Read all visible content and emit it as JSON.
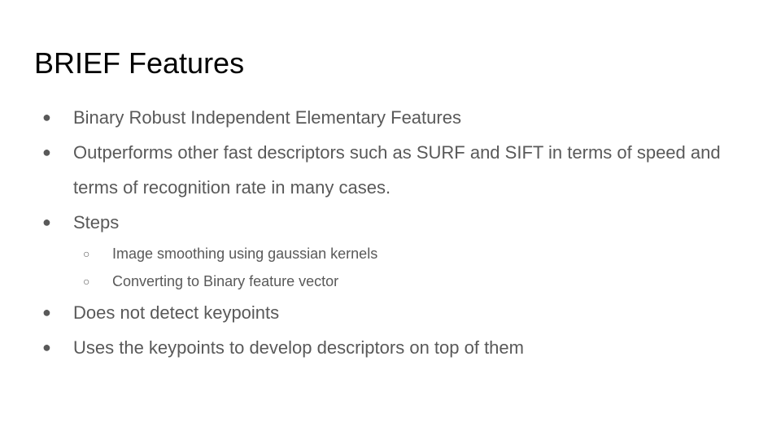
{
  "slide": {
    "title": "BRIEF Features",
    "bullets": [
      {
        "marker": "●",
        "text": "Binary Robust Independent Elementary Features"
      },
      {
        "marker": "●",
        "text": "Outperforms other fast descriptors such as SURF and SIFT in terms of speed and terms of recognition rate in many cases."
      },
      {
        "marker": "●",
        "text": "Steps"
      },
      {
        "marker": "●",
        "text": "Does not detect keypoints"
      },
      {
        "marker": "●",
        "text": "Uses the keypoints to develop descriptors on top of them"
      }
    ],
    "sub_bullets": [
      {
        "marker": "○",
        "text": "Image smoothing using gaussian kernels"
      },
      {
        "marker": "○",
        "text": "Converting to Binary feature vector"
      }
    ],
    "colors": {
      "title": "#000000",
      "body_text": "#595959",
      "background": "#ffffff"
    }
  }
}
